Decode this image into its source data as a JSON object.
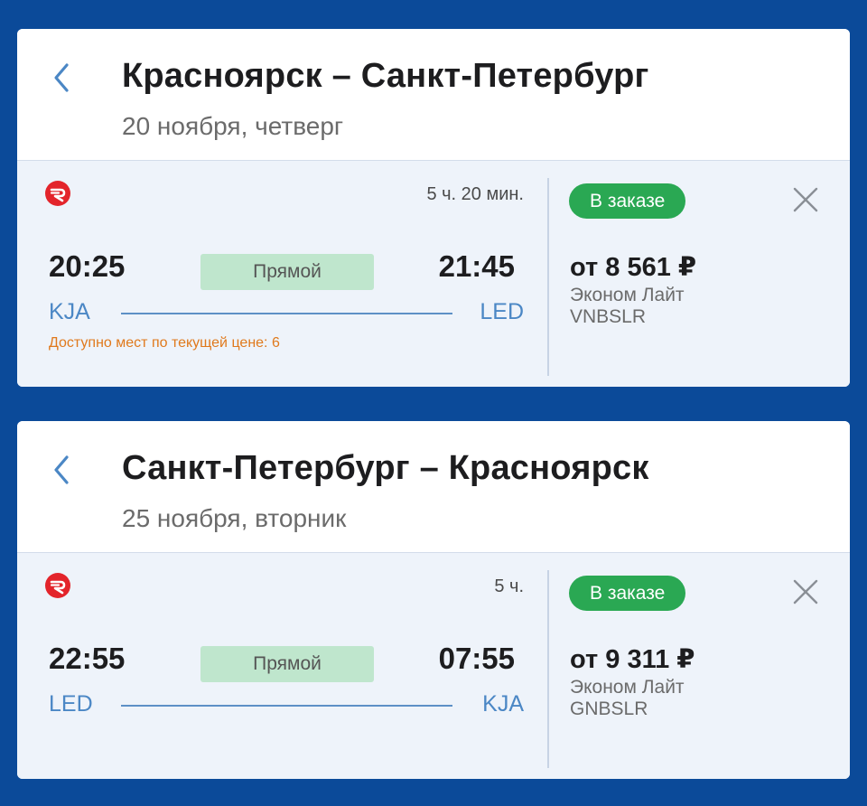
{
  "colors": {
    "background": "#0b4a99",
    "accent_blue": "#4b87c5",
    "order_green": "#2aa853",
    "direct_green": "#bfe6cd",
    "warning_orange": "#e0791c",
    "airline_red": "#e3242b"
  },
  "icons": {
    "back": "chevron-left-icon",
    "close": "close-icon",
    "airline": "airline-logo-icon"
  },
  "outbound": {
    "title": "Красноярск – Санкт-Петербург",
    "date": "20 ноября, четверг",
    "flight": {
      "duration": "5 ч. 20 мин.",
      "departure_time": "20:25",
      "arrival_time": "21:45",
      "stops_label": "Прямой",
      "from_code": "KJA",
      "to_code": "LED",
      "seats_note": "Доступно мест по текущей цене: 6",
      "status": "В заказе",
      "price": "от 8 561 ₽",
      "fare_class": "Эконом Лайт",
      "fare_code": "VNBSLR"
    }
  },
  "return": {
    "title": "Санкт-Петербург – Красноярск",
    "date": "25 ноября, вторник",
    "flight": {
      "duration": "5 ч.",
      "departure_time": "22:55",
      "arrival_time": "07:55",
      "stops_label": "Прямой",
      "from_code": "LED",
      "to_code": "KJA",
      "status": "В заказе",
      "price": "от 9 311 ₽",
      "fare_class": "Эконом Лайт",
      "fare_code": "GNBSLR"
    }
  }
}
